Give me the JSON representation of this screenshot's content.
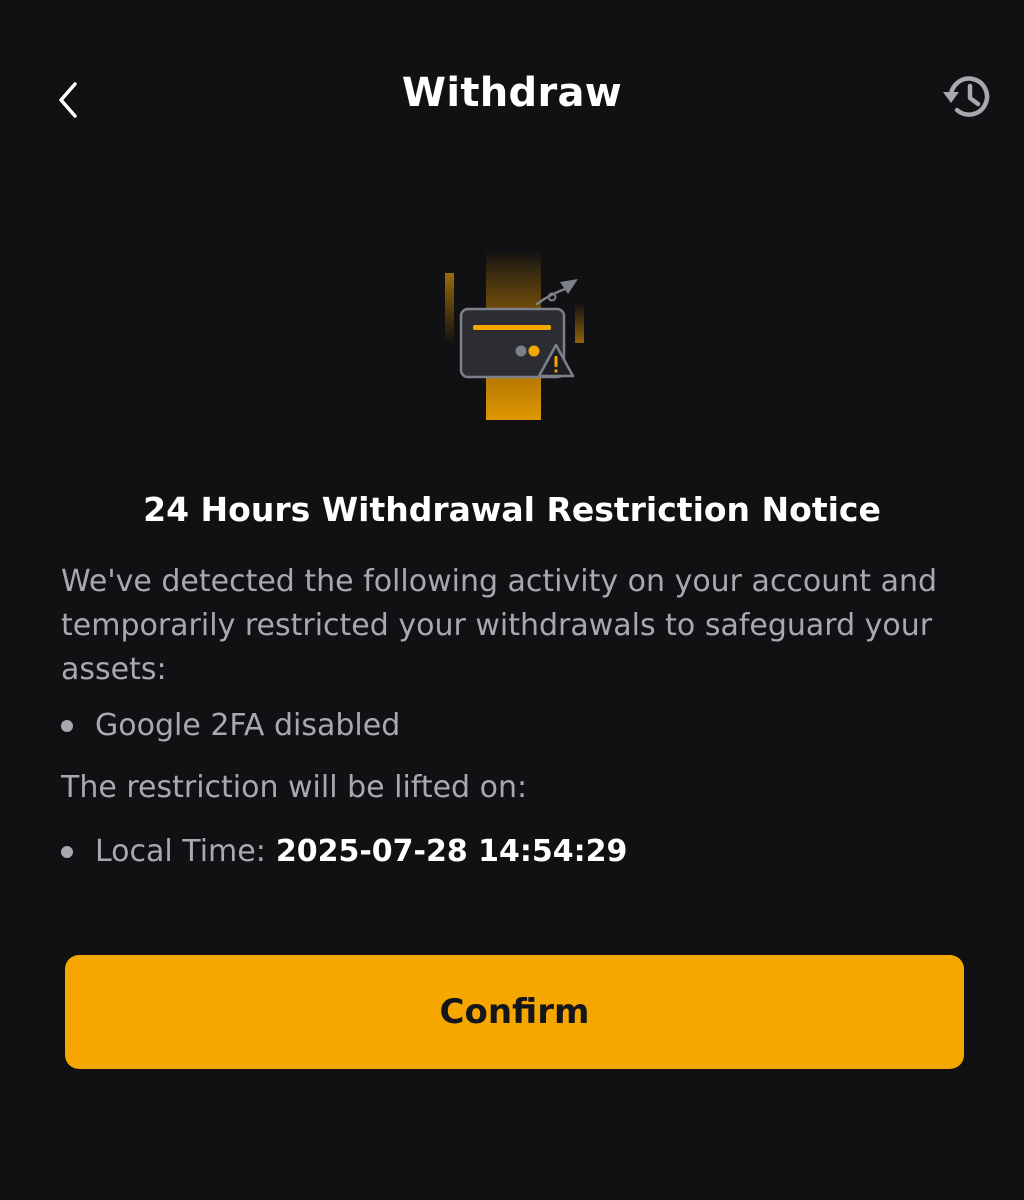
{
  "header": {
    "title": "Withdraw",
    "back_icon": "chevron-left-icon",
    "history_icon": "history-icon"
  },
  "illustration": {
    "icon": "card-warning-illustration",
    "accent_color": "#f5a700"
  },
  "notice": {
    "title": "24 Hours Withdrawal Restriction Notice",
    "description": "We've detected the following activity on your account and temporarily restricted your withdrawals to safeguard your assets:",
    "activities": [
      "Google 2FA disabled"
    ],
    "lift_label": "The restriction will be lifted on:",
    "local_time_label": "Local Time:",
    "local_time_value": "2025-07-28 14:54:29"
  },
  "actions": {
    "confirm_label": "Confirm"
  },
  "colors": {
    "background": "#111114",
    "primary": "#f5a700",
    "text_primary": "#ffffff",
    "text_secondary": "#a6a9b0"
  }
}
